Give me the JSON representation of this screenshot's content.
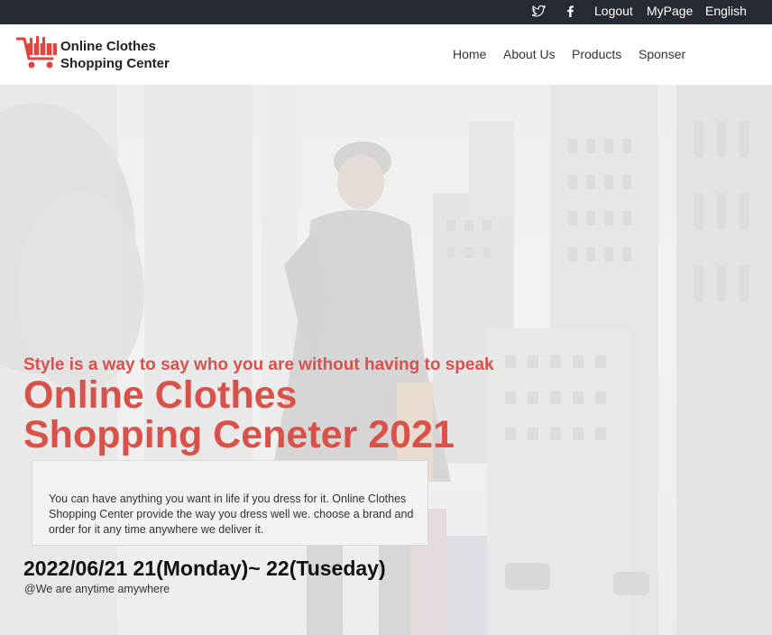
{
  "topbar": {
    "social": [
      {
        "icon": "twitter-icon"
      },
      {
        "icon": "facebook-icon"
      }
    ],
    "logout": "Logout",
    "mypage": "MyPage",
    "language": "English"
  },
  "header": {
    "logo_icon": "shopping-cart-icon",
    "brand_line1": "Online Clothes",
    "brand_line2": "Shopping Center",
    "nav": [
      "Home",
      "About Us",
      "Products",
      "Sponser"
    ]
  },
  "hero": {
    "tagline": "Style is a way to say who you are without having to speak",
    "title_line1": "Online Clothes",
    "title_line2": "Shopping Ceneter 2021",
    "description": "You can have anything you want in life if you dress for it. Online Clothes Shopping Center provide the way you dress well we. choose a brand and order for it any time anywhere we deliver it.",
    "date": "2022/06/21 21(Monday)~ 22(Tuseday)",
    "location": "@We are anytime amywhere"
  },
  "colors": {
    "accent": "#d9524a",
    "topbar_bg": "#252a33"
  }
}
